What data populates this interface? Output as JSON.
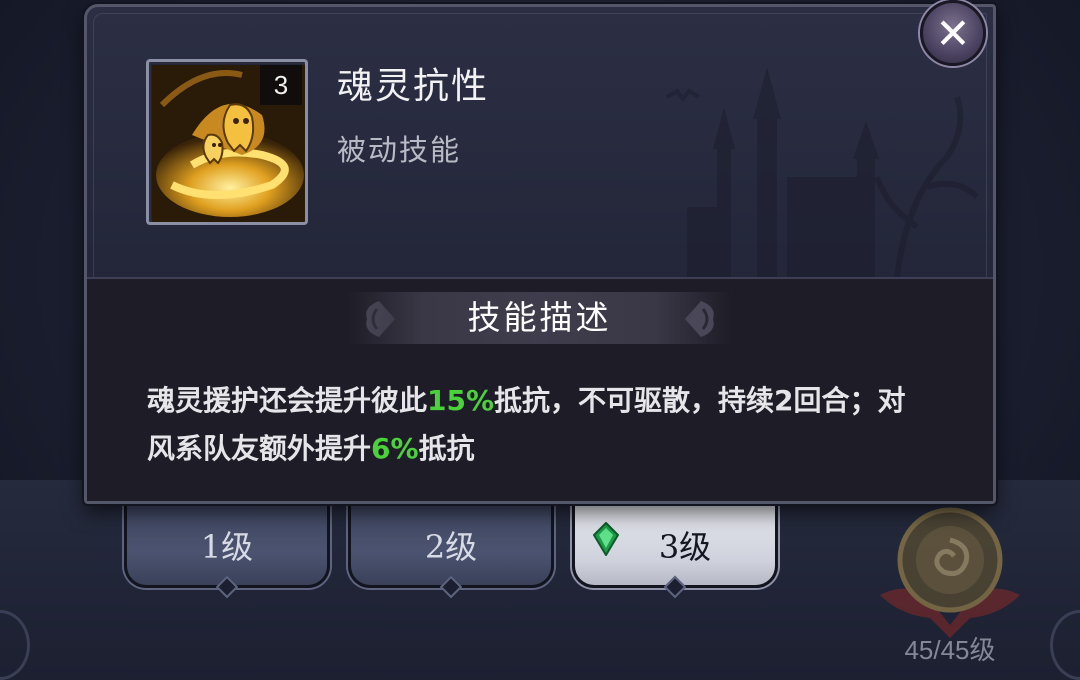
{
  "skill": {
    "name": "魂灵抗性",
    "type": "被动技能",
    "icon_level": "3",
    "icon": "ghost-vortex-icon"
  },
  "description": {
    "header": "技能描述",
    "segments": [
      {
        "text": "魂灵援护还会提升彼此",
        "highlight": false
      },
      {
        "text": "15%",
        "highlight": true
      },
      {
        "text": "抵抗，不可驱散，持续2回合；对风系队友额外提升",
        "highlight": false
      },
      {
        "text": "6%",
        "highlight": true
      },
      {
        "text": "抵抗",
        "highlight": false
      }
    ]
  },
  "close_button": {
    "icon": "close-icon",
    "glyph": "✕"
  },
  "level_tabs": [
    {
      "label": "1级",
      "active": false
    },
    {
      "label": "2级",
      "active": false
    },
    {
      "label": "3级",
      "active": true
    }
  ],
  "emblem": {
    "level_text": "45/45级"
  },
  "colors": {
    "highlight": "#4bd13b",
    "panel": "#24273a",
    "tab_active": "#d8d9e2"
  }
}
